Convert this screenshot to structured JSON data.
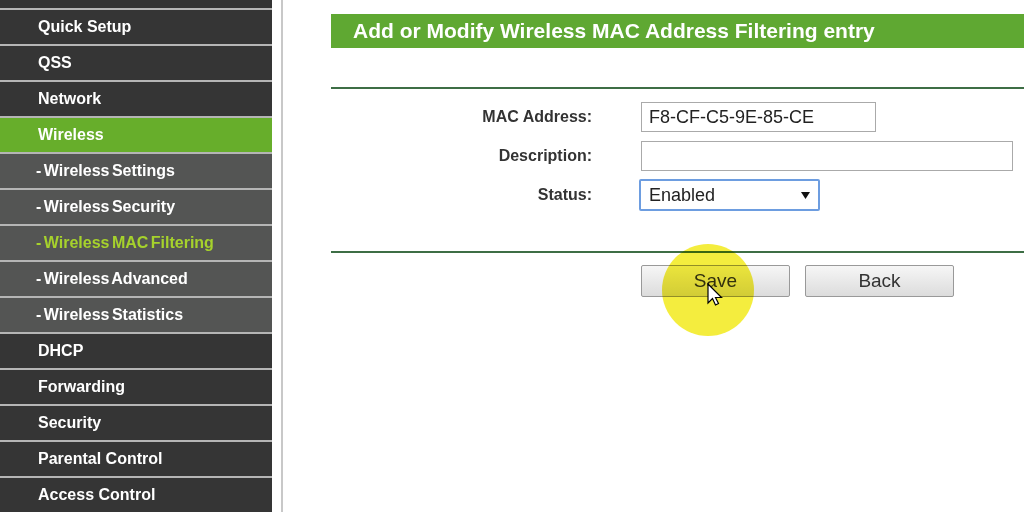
{
  "sidebar": {
    "items": [
      {
        "label": "Quick Setup",
        "kind": "main",
        "selected": false
      },
      {
        "label": "QSS",
        "kind": "main",
        "selected": false
      },
      {
        "label": "Network",
        "kind": "main",
        "selected": false
      },
      {
        "label": "Wireless",
        "kind": "main",
        "selected": true
      },
      {
        "label": "- Wireless Settings",
        "kind": "sub",
        "selected": false
      },
      {
        "label": "- Wireless Security",
        "kind": "sub",
        "selected": false
      },
      {
        "label": "- Wireless MAC Filtering",
        "kind": "sub",
        "selected": true
      },
      {
        "label": "- Wireless Advanced",
        "kind": "sub",
        "selected": false
      },
      {
        "label": "- Wireless Statistics",
        "kind": "sub",
        "selected": false
      },
      {
        "label": "DHCP",
        "kind": "main",
        "selected": false
      },
      {
        "label": "Forwarding",
        "kind": "main",
        "selected": false
      },
      {
        "label": "Security",
        "kind": "main",
        "selected": false
      },
      {
        "label": "Parental Control",
        "kind": "main",
        "selected": false
      },
      {
        "label": "Access Control",
        "kind": "main",
        "selected": false
      }
    ]
  },
  "form": {
    "title": "Add or Modify Wireless MAC Address Filtering entry",
    "fields": [
      {
        "label": "MAC Address:",
        "kind": "text",
        "value": "F8-CF-C5-9E-85-CE"
      },
      {
        "label": "Description:",
        "kind": "wide"
      },
      {
        "label": "Status:",
        "kind": "select",
        "value": "Enabled"
      }
    ],
    "buttons": [
      "Save",
      "Back"
    ]
  }
}
